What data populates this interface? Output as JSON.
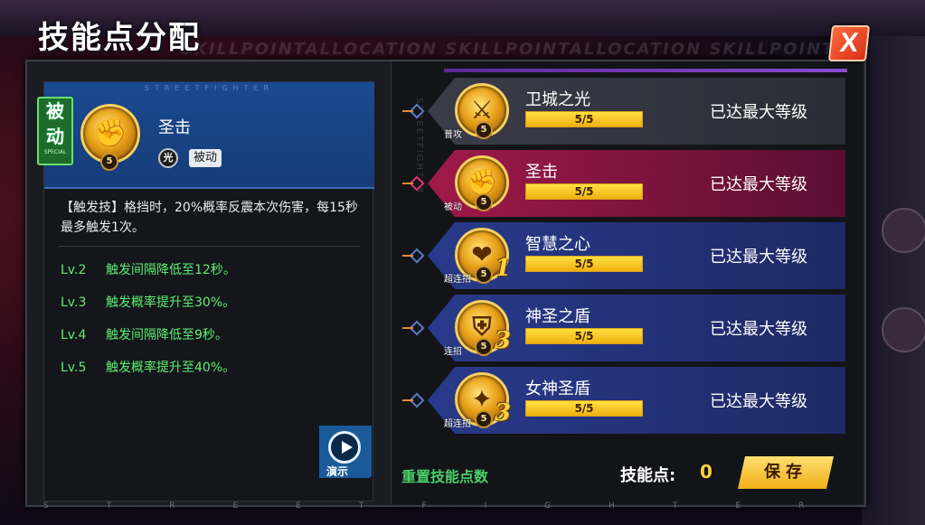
{
  "title": "技能点分配",
  "subtitle": "SKILLPOINTALLOCATION SKILLPOINTALLOCATION SKILLPOINTALLOCATION",
  "close_label": "X",
  "selected_skill": {
    "tag_big": "被动",
    "tag_small": "SPECIAL",
    "level": "5",
    "name": "圣击",
    "element": "光",
    "type": "被动",
    "description": "【触发技】格挡时，20%概率反震本次伤害，每15秒最多触发1次。",
    "levels": [
      {
        "lv": "Lv.2",
        "text": "触发间隔降低至12秒。"
      },
      {
        "lv": "Lv.3",
        "text": "触发概率提升至30%。"
      },
      {
        "lv": "Lv.4",
        "text": "触发间隔降低至9秒。"
      },
      {
        "lv": "Lv.5",
        "text": "触发概率提升至40%。"
      }
    ],
    "demo_label": "演示"
  },
  "strip_text": "STREETFIGHTER",
  "skills": [
    {
      "name": "卫城之光",
      "kind": "普攻",
      "level": "5",
      "combo": "",
      "progress": "5/5",
      "fill": 1.0,
      "status": "已达最大等级",
      "style": "gray",
      "icon": "spear-icon"
    },
    {
      "name": "圣击",
      "kind": "被动",
      "level": "5",
      "combo": "",
      "progress": "5/5",
      "fill": 1.0,
      "status": "已达最大等级",
      "style": "selected",
      "icon": "fist-icon"
    },
    {
      "name": "智慧之心",
      "kind": "超连招",
      "level": "5",
      "combo": "1",
      "progress": "5/5",
      "fill": 1.0,
      "status": "已达最大等级",
      "style": "blue",
      "icon": "heart-icon"
    },
    {
      "name": "神圣之盾",
      "kind": "连招",
      "level": "5",
      "combo": "3",
      "progress": "5/5",
      "fill": 1.0,
      "status": "已达最大等级",
      "style": "blue",
      "icon": "shield-icon"
    },
    {
      "name": "女神圣盾",
      "kind": "超连招",
      "level": "5",
      "combo": "3",
      "progress": "5/5",
      "fill": 1.0,
      "status": "已达最大等级",
      "style": "blue",
      "icon": "goddess-shield-icon"
    }
  ],
  "footer": {
    "reset_label": "重置技能点数",
    "skill_points_label": "技能点:",
    "skill_points_value": "0",
    "save_label": "保存"
  }
}
